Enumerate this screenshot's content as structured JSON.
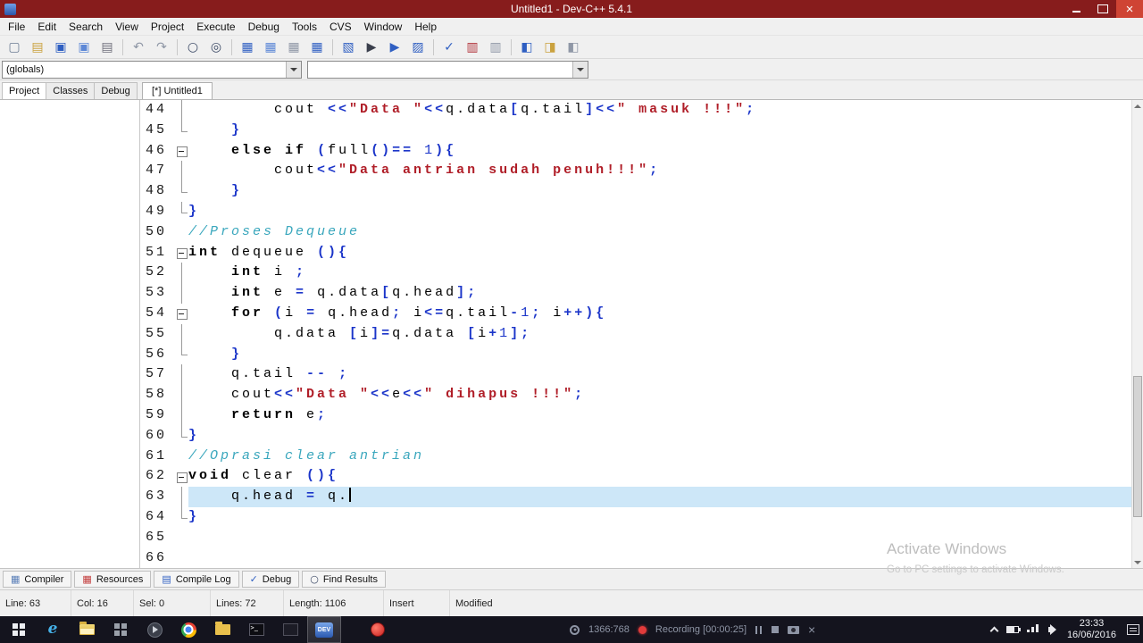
{
  "colors": {
    "titlebar": "#871c1c",
    "taskbar": "#14141e",
    "hl": "#cde7f8",
    "op": "#1b35c9",
    "num": "#1b35c9",
    "str": "#b01e28",
    "com": "#3aa7bd"
  },
  "titlebar": {
    "title": "Untitled1 - Dev-C++ 5.4.1"
  },
  "menu": [
    "File",
    "Edit",
    "Search",
    "View",
    "Project",
    "Execute",
    "Debug",
    "Tools",
    "CVS",
    "Window",
    "Help"
  ],
  "toolbar": {
    "groups": [
      [
        {
          "name": "new-file",
          "glyph": "▢",
          "color": "#6b7b93"
        },
        {
          "name": "open-file",
          "glyph": "▤",
          "color": "#caa23f"
        },
        {
          "name": "save",
          "glyph": "▣",
          "color": "#2f5fc2"
        },
        {
          "name": "save-all",
          "glyph": "▣",
          "color": "#5c87d6"
        },
        {
          "name": "print",
          "glyph": "▤",
          "color": "#70707c"
        }
      ],
      [
        {
          "name": "undo",
          "glyph": "↶",
          "color": "#8f97a6"
        },
        {
          "name": "redo",
          "glyph": "↷",
          "color": "#8f97a6"
        }
      ],
      [
        {
          "name": "find",
          "glyph": "○",
          "color": "#3c4a66"
        },
        {
          "name": "replace",
          "glyph": "◎",
          "color": "#3c4a66"
        }
      ],
      [
        {
          "name": "new-project",
          "glyph": "▦",
          "color": "#2f5fc2"
        },
        {
          "name": "add-to-project",
          "glyph": "▦",
          "color": "#5c87d6"
        },
        {
          "name": "remove-from-project",
          "glyph": "▦",
          "color": "#8f97a6"
        },
        {
          "name": "project-options",
          "glyph": "▦",
          "color": "#2f5fc2"
        }
      ],
      [
        {
          "name": "compile",
          "glyph": "▧",
          "color": "#2f5fc2"
        },
        {
          "name": "run",
          "glyph": "▶",
          "color": "#3a3f4c"
        },
        {
          "name": "compile-and-run",
          "glyph": "▶",
          "color": "#2f5fc2"
        },
        {
          "name": "rebuild-all",
          "glyph": "▨",
          "color": "#2f5fc2"
        }
      ],
      [
        {
          "name": "syntax-check",
          "glyph": "✓",
          "color": "#2f5fc2"
        },
        {
          "name": "profile",
          "glyph": "▥",
          "color": "#b13239"
        },
        {
          "name": "profiling-log",
          "glyph": "▥",
          "color": "#8f97a6"
        }
      ],
      [
        {
          "name": "insert",
          "glyph": "◧",
          "color": "#2f5fc2"
        },
        {
          "name": "toggle-bookmark",
          "glyph": "◨",
          "color": "#caa23f"
        },
        {
          "name": "goto-bookmark",
          "glyph": "◧",
          "color": "#8f97a6"
        }
      ]
    ]
  },
  "selectors": {
    "globals": "(globals)",
    "members": ""
  },
  "panel_tabs": [
    {
      "key": "project",
      "label": "Project",
      "active": true
    },
    {
      "key": "classes",
      "label": "Classes",
      "active": false
    },
    {
      "key": "debug",
      "label": "Debug",
      "active": false
    }
  ],
  "editor_tabs": [
    {
      "key": "untitled1",
      "label": "[*] Untitled1",
      "active": true
    }
  ],
  "editor": {
    "caret_line": 63,
    "lines": [
      {
        "n": 44,
        "fold": "mid",
        "segs": [
          {
            "t": "        cout ",
            "s": "id"
          },
          {
            "t": "<<",
            "s": "op"
          },
          {
            "t": "\"Data \"",
            "s": "str"
          },
          {
            "t": "<<",
            "s": "op"
          },
          {
            "t": "q.data",
            "s": "id"
          },
          {
            "t": "[",
            "s": "op"
          },
          {
            "t": "q.tail",
            "s": "id"
          },
          {
            "t": "]<<",
            "s": "op"
          },
          {
            "t": "\" masuk !!!\"",
            "s": "str"
          },
          {
            "t": ";",
            "s": "op"
          }
        ]
      },
      {
        "n": 45,
        "fold": "end",
        "segs": [
          {
            "t": "    ",
            "s": "id"
          },
          {
            "t": "}",
            "s": "op"
          }
        ]
      },
      {
        "n": 46,
        "fold": "start",
        "segs": [
          {
            "t": "    ",
            "s": "id"
          },
          {
            "t": "else",
            "s": "kw"
          },
          {
            "t": " ",
            "s": "id"
          },
          {
            "t": "if",
            "s": "kw"
          },
          {
            "t": " ",
            "s": "id"
          },
          {
            "t": "(",
            "s": "op"
          },
          {
            "t": "full",
            "s": "id"
          },
          {
            "t": "()==",
            "s": "op"
          },
          {
            "t": " ",
            "s": "id"
          },
          {
            "t": "1",
            "s": "num"
          },
          {
            "t": "){",
            "s": "op"
          }
        ]
      },
      {
        "n": 47,
        "fold": "mid",
        "segs": [
          {
            "t": "        cout",
            "s": "id"
          },
          {
            "t": "<<",
            "s": "op"
          },
          {
            "t": "\"Data antrian sudah penuh!!!\"",
            "s": "str"
          },
          {
            "t": ";",
            "s": "op"
          }
        ]
      },
      {
        "n": 48,
        "fold": "end",
        "segs": [
          {
            "t": "    ",
            "s": "id"
          },
          {
            "t": "}",
            "s": "op"
          }
        ]
      },
      {
        "n": 49,
        "fold": "end",
        "segs": [
          {
            "t": "}",
            "s": "op"
          }
        ]
      },
      {
        "n": 50,
        "fold": "none",
        "segs": [
          {
            "t": "//Proses Dequeue",
            "s": "com"
          }
        ]
      },
      {
        "n": 51,
        "fold": "start",
        "segs": [
          {
            "t": "int",
            "s": "kw"
          },
          {
            "t": " dequeue ",
            "s": "id"
          },
          {
            "t": "(){",
            "s": "op"
          }
        ]
      },
      {
        "n": 52,
        "fold": "mid",
        "segs": [
          {
            "t": "    ",
            "s": "id"
          },
          {
            "t": "int",
            "s": "kw"
          },
          {
            "t": " i ",
            "s": "id"
          },
          {
            "t": ";",
            "s": "op"
          }
        ]
      },
      {
        "n": 53,
        "fold": "mid",
        "segs": [
          {
            "t": "    ",
            "s": "id"
          },
          {
            "t": "int",
            "s": "kw"
          },
          {
            "t": " e ",
            "s": "id"
          },
          {
            "t": "=",
            "s": "op"
          },
          {
            "t": " q.data",
            "s": "id"
          },
          {
            "t": "[",
            "s": "op"
          },
          {
            "t": "q.head",
            "s": "id"
          },
          {
            "t": "];",
            "s": "op"
          }
        ]
      },
      {
        "n": 54,
        "fold": "start",
        "segs": [
          {
            "t": "    ",
            "s": "id"
          },
          {
            "t": "for",
            "s": "kw"
          },
          {
            "t": " ",
            "s": "id"
          },
          {
            "t": "(",
            "s": "op"
          },
          {
            "t": "i ",
            "s": "id"
          },
          {
            "t": "=",
            "s": "op"
          },
          {
            "t": " q.head",
            "s": "id"
          },
          {
            "t": ";",
            "s": "op"
          },
          {
            "t": " i",
            "s": "id"
          },
          {
            "t": "<=",
            "s": "op"
          },
          {
            "t": "q.tail",
            "s": "id"
          },
          {
            "t": "-",
            "s": "op"
          },
          {
            "t": "1",
            "s": "num"
          },
          {
            "t": ";",
            "s": "op"
          },
          {
            "t": " i",
            "s": "id"
          },
          {
            "t": "++){",
            "s": "op"
          }
        ]
      },
      {
        "n": 55,
        "fold": "mid",
        "segs": [
          {
            "t": "        q.data ",
            "s": "id"
          },
          {
            "t": "[",
            "s": "op"
          },
          {
            "t": "i",
            "s": "id"
          },
          {
            "t": "]=",
            "s": "op"
          },
          {
            "t": "q.data ",
            "s": "id"
          },
          {
            "t": "[",
            "s": "op"
          },
          {
            "t": "i",
            "s": "id"
          },
          {
            "t": "+",
            "s": "op"
          },
          {
            "t": "1",
            "s": "num"
          },
          {
            "t": "];",
            "s": "op"
          }
        ]
      },
      {
        "n": 56,
        "fold": "end",
        "segs": [
          {
            "t": "    ",
            "s": "id"
          },
          {
            "t": "}",
            "s": "op"
          }
        ]
      },
      {
        "n": 57,
        "fold": "mid",
        "segs": [
          {
            "t": "    q.tail ",
            "s": "id"
          },
          {
            "t": "--",
            "s": "op"
          },
          {
            "t": " ",
            "s": "id"
          },
          {
            "t": ";",
            "s": "op"
          }
        ]
      },
      {
        "n": 58,
        "fold": "mid",
        "segs": [
          {
            "t": "    cout",
            "s": "id"
          },
          {
            "t": "<<",
            "s": "op"
          },
          {
            "t": "\"Data \"",
            "s": "str"
          },
          {
            "t": "<<",
            "s": "op"
          },
          {
            "t": "e",
            "s": "id"
          },
          {
            "t": "<<",
            "s": "op"
          },
          {
            "t": "\" dihapus !!!\"",
            "s": "str"
          },
          {
            "t": ";",
            "s": "op"
          }
        ]
      },
      {
        "n": 59,
        "fold": "mid",
        "segs": [
          {
            "t": "    ",
            "s": "id"
          },
          {
            "t": "return",
            "s": "kw"
          },
          {
            "t": " e",
            "s": "id"
          },
          {
            "t": ";",
            "s": "op"
          }
        ]
      },
      {
        "n": 60,
        "fold": "end",
        "segs": [
          {
            "t": "}",
            "s": "op"
          }
        ]
      },
      {
        "n": 61,
        "fold": "none",
        "segs": [
          {
            "t": "//Oprasi clear antrian",
            "s": "com"
          }
        ]
      },
      {
        "n": 62,
        "fold": "start",
        "segs": [
          {
            "t": "void",
            "s": "kw"
          },
          {
            "t": " clear ",
            "s": "id"
          },
          {
            "t": "(){",
            "s": "op"
          }
        ]
      },
      {
        "n": 63,
        "fold": "mid",
        "segs": [
          {
            "t": "    q.head ",
            "s": "id"
          },
          {
            "t": "=",
            "s": "op"
          },
          {
            "t": " q.",
            "s": "id"
          }
        ]
      },
      {
        "n": 64,
        "fold": "end",
        "segs": [
          {
            "t": "}",
            "s": "op"
          }
        ]
      },
      {
        "n": 65,
        "fold": "none",
        "segs": []
      },
      {
        "n": 66,
        "fold": "none",
        "segs": []
      }
    ]
  },
  "bottom_tabs": [
    {
      "key": "compiler",
      "label": "Compiler",
      "glyph": "▦",
      "color": "#5b7fb8"
    },
    {
      "key": "resources",
      "label": "Resources",
      "glyph": "▦",
      "color": "#c23b3b"
    },
    {
      "key": "compile-log",
      "label": "Compile Log",
      "glyph": "▤",
      "color": "#2f5fc2"
    },
    {
      "key": "debug",
      "label": "Debug",
      "glyph": "✓",
      "color": "#2f5fc2"
    },
    {
      "key": "find-results",
      "label": "Find Results",
      "glyph": "○",
      "color": "#3c4a66"
    }
  ],
  "statusbar": [
    {
      "key": "line",
      "text": "Line: 63"
    },
    {
      "key": "col",
      "text": "Col: 16"
    },
    {
      "key": "sel",
      "text": "Sel: 0"
    },
    {
      "key": "lines",
      "text": "Lines: 72"
    },
    {
      "key": "length",
      "text": "Length: 1106"
    },
    {
      "key": "insert",
      "text": "Insert"
    },
    {
      "key": "modified",
      "text": "Modified"
    }
  ],
  "watermark": {
    "line1": "Activate Windows",
    "line2": "Go to PC settings to activate Windows."
  },
  "taskbar": {
    "apps": [
      {
        "name": "start-button",
        "icon": "windows-logo-icon",
        "type": "win"
      },
      {
        "name": "ie-taskbar-button",
        "icon": "internet-explorer-icon",
        "type": "ie"
      },
      {
        "name": "explorer-taskbar-button",
        "icon": "file-explorer-icon",
        "type": "explorer"
      },
      {
        "name": "tiles-taskbar-button",
        "icon": "app-tiles-icon",
        "type": "tiles"
      },
      {
        "name": "media-taskbar-button",
        "icon": "media-player-icon",
        "type": "media"
      },
      {
        "name": "chrome-taskbar-button",
        "icon": "chrome-icon",
        "type": "chrome"
      },
      {
        "name": "folder-taskbar-button",
        "icon": "folder-icon",
        "type": "folder"
      },
      {
        "name": "cmd-taskbar-button",
        "icon": "command-prompt-icon",
        "type": "cmd"
      },
      {
        "name": "console-taskbar-button",
        "icon": "console-window-icon",
        "type": "cmd2"
      },
      {
        "name": "devcpp-taskbar-button",
        "icon": "devcpp-icon",
        "type": "dev",
        "label": "DEV",
        "active": true
      },
      {
        "name": "recorder-taskbar-button",
        "icon": "record-icon",
        "type": "record",
        "push": true
      }
    ],
    "recorder": {
      "resolution": "1366:768",
      "status": "Recording [00:00:25]"
    },
    "clock": {
      "time": "23:33",
      "date": "16/06/2016"
    }
  }
}
